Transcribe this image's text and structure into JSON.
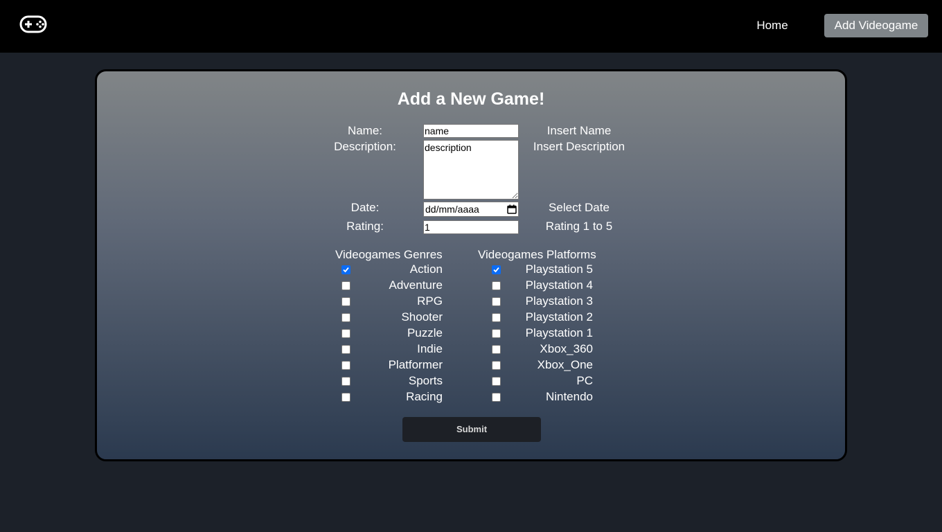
{
  "nav": {
    "logo_icon": "gamepad-icon",
    "home_label": "Home",
    "add_label": "Add Videogame",
    "active_bg": "#7f8589"
  },
  "form": {
    "title": "Add a New Game!",
    "name": {
      "label": "Name:",
      "value": "name",
      "hint": "Insert Name"
    },
    "description": {
      "label": "Description:",
      "value": "description",
      "hint": "Insert Description"
    },
    "date": {
      "label": "Date:",
      "placeholder": "dd/mm/aaaa",
      "hint": "Select Date",
      "icon": "calendar-icon"
    },
    "rating": {
      "label": "Rating:",
      "value": "1",
      "hint": "Rating 1 to 5"
    },
    "genres": {
      "title": "Videogames Genres",
      "items": [
        {
          "label": "Action",
          "checked": true
        },
        {
          "label": "Adventure",
          "checked": false
        },
        {
          "label": "RPG",
          "checked": false
        },
        {
          "label": "Shooter",
          "checked": false
        },
        {
          "label": "Puzzle",
          "checked": false
        },
        {
          "label": "Indie",
          "checked": false
        },
        {
          "label": "Platformer",
          "checked": false
        },
        {
          "label": "Sports",
          "checked": false
        },
        {
          "label": "Racing",
          "checked": false
        }
      ]
    },
    "platforms": {
      "title": "Videogames Platforms",
      "items": [
        {
          "label": "Playstation 5",
          "checked": true
        },
        {
          "label": "Playstation 4",
          "checked": false
        },
        {
          "label": "Playstation 3",
          "checked": false
        },
        {
          "label": "Playstation 2",
          "checked": false
        },
        {
          "label": "Playstation 1",
          "checked": false
        },
        {
          "label": "Xbox_360",
          "checked": false
        },
        {
          "label": "Xbox_One",
          "checked": false
        },
        {
          "label": "PC",
          "checked": false
        },
        {
          "label": "Nintendo",
          "checked": false
        }
      ]
    },
    "submit_label": "Submit"
  }
}
